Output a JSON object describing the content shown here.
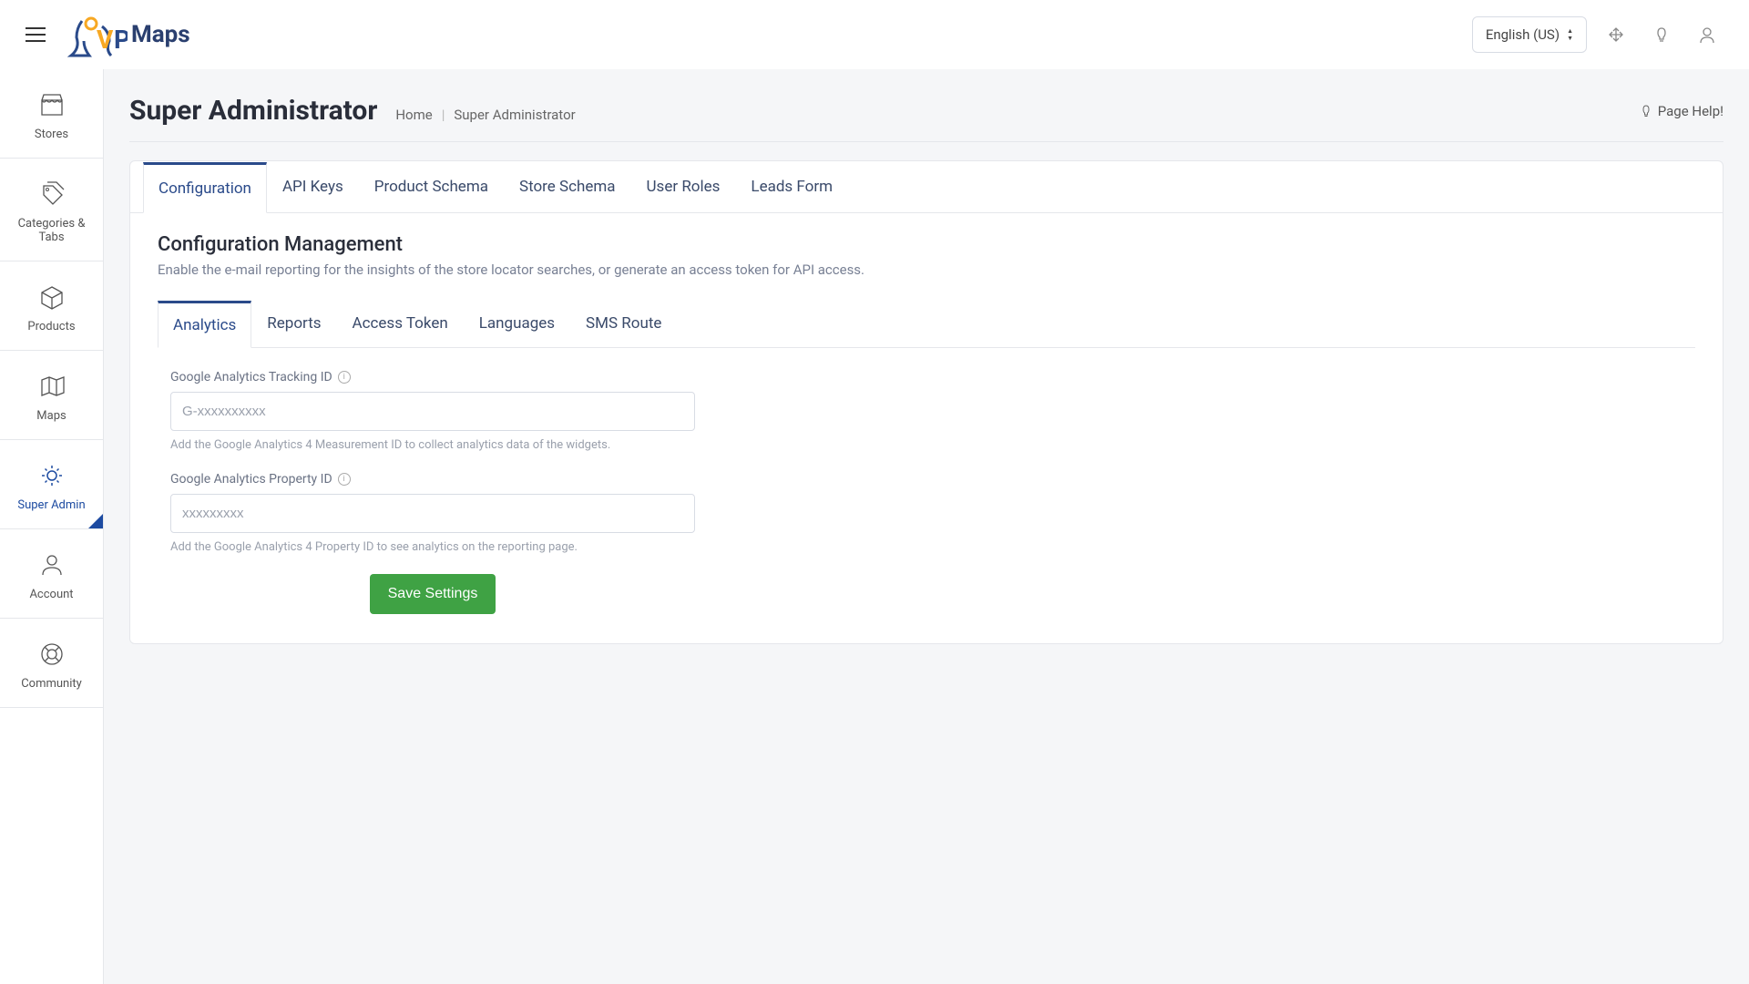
{
  "header": {
    "logo_text": "Maps",
    "language": "English (US)"
  },
  "sidebar": {
    "items": [
      {
        "label": "Stores"
      },
      {
        "label": "Categories & Tabs"
      },
      {
        "label": "Products"
      },
      {
        "label": "Maps"
      },
      {
        "label": "Super Admin"
      },
      {
        "label": "Account"
      },
      {
        "label": "Community"
      }
    ]
  },
  "page": {
    "title": "Super Administrator",
    "breadcrumb_home": "Home",
    "breadcrumb_current": "Super Administrator",
    "help_label": "Page Help!"
  },
  "tabs": [
    {
      "label": "Configuration"
    },
    {
      "label": "API Keys"
    },
    {
      "label": "Product Schema"
    },
    {
      "label": "Store Schema"
    },
    {
      "label": "User Roles"
    },
    {
      "label": "Leads Form"
    }
  ],
  "config": {
    "title": "Configuration Management",
    "description": "Enable the e-mail reporting for the insights of the store locator searches, or generate an access token for API access."
  },
  "subtabs": [
    {
      "label": "Analytics"
    },
    {
      "label": "Reports"
    },
    {
      "label": "Access Token"
    },
    {
      "label": "Languages"
    },
    {
      "label": "SMS Route"
    }
  ],
  "form": {
    "ga_tracking": {
      "label": "Google Analytics Tracking ID",
      "placeholder": "G-xxxxxxxxxx",
      "help": "Add the Google Analytics 4 Measurement ID to collect analytics data of the widgets."
    },
    "ga_property": {
      "label": "Google Analytics Property ID",
      "placeholder": "xxxxxxxxx",
      "help": "Add the Google Analytics 4 Property ID to see analytics on the reporting page."
    },
    "save_label": "Save Settings"
  }
}
